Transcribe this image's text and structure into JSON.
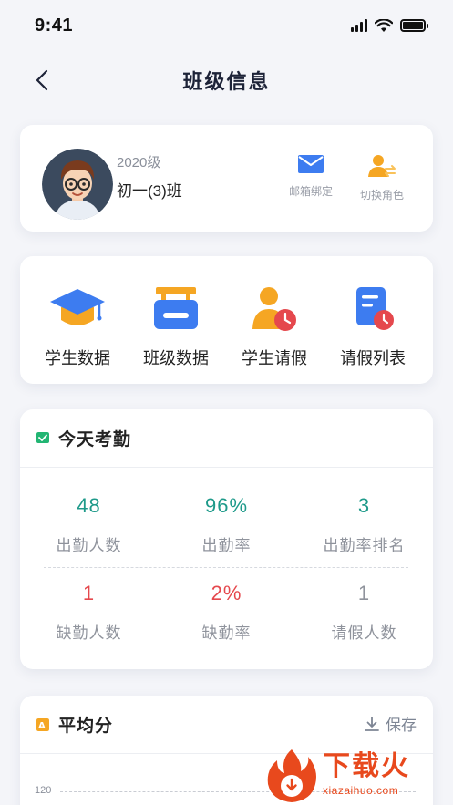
{
  "status_bar": {
    "time": "9:41"
  },
  "nav": {
    "title": "班级信息"
  },
  "profile": {
    "grade": "2020级",
    "class_name": "初一(3)班",
    "actions": [
      {
        "label": "邮箱绑定",
        "icon": "mail-icon"
      },
      {
        "label": "切换角色",
        "icon": "switch-role-icon"
      }
    ]
  },
  "menu": {
    "items": [
      {
        "label": "学生数据",
        "icon": "graduation-cap-icon"
      },
      {
        "label": "班级数据",
        "icon": "class-board-icon"
      },
      {
        "label": "学生请假",
        "icon": "student-leave-icon"
      },
      {
        "label": "请假列表",
        "icon": "leave-list-icon"
      }
    ]
  },
  "attendance": {
    "title": "今天考勤",
    "stats": [
      {
        "value": "48",
        "label": "出勤人数",
        "color": "#1e9a8a"
      },
      {
        "value": "96%",
        "label": "出勤率",
        "color": "#1e9a8a"
      },
      {
        "value": "3",
        "label": "出勤率排名",
        "color": "#1e9a8a"
      },
      {
        "value": "1",
        "label": "缺勤人数",
        "color": "#e5484d"
      },
      {
        "value": "2%",
        "label": "缺勤率",
        "color": "#e5484d"
      },
      {
        "value": "1",
        "label": "请假人数",
        "color": "#8f939c"
      }
    ]
  },
  "average": {
    "title": "平均分",
    "save_label": "保存",
    "axis_tick": "120"
  },
  "watermark": {
    "main": "下载火",
    "sub": "xiazaihuo.com"
  },
  "colors": {
    "accent_teal": "#1e9a8a",
    "alert_red": "#e5484d",
    "title_navy": "#1d2338",
    "icon_blue": "#3d7cf0",
    "icon_orange": "#f5a623"
  }
}
